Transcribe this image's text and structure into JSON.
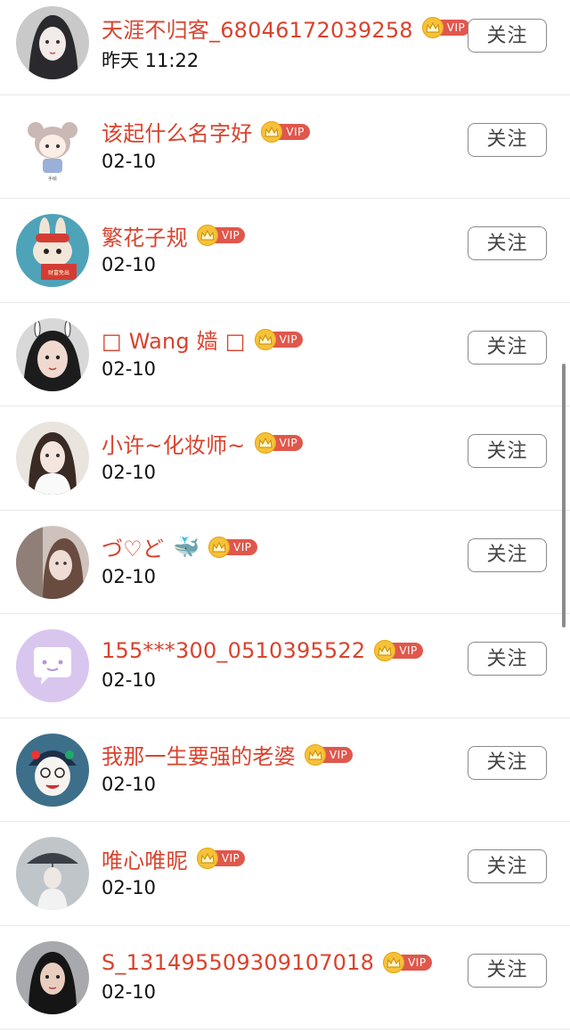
{
  "follow_label": "关注",
  "vip_label": "VIP",
  "colors": {
    "name": "#d9432e",
    "vip_badge": "#e0574c",
    "crown": "#f6c23a",
    "divider": "#e9e9e9"
  },
  "users": [
    {
      "name": "天涯不归客_68046172039258",
      "time": "昨天 11:22",
      "avatar": "girl-illustration-avatar"
    },
    {
      "name": "该起什么名字好",
      "time": "02-10",
      "avatar": "cartoon-girl-avatar"
    },
    {
      "name": "繁花子规",
      "time": "02-10",
      "avatar": "rabbit-avatar"
    },
    {
      "name": "□  Wang 嫱 □",
      "time": "02-10",
      "avatar": "selfie-avatar"
    },
    {
      "name": "小许~化妆师~",
      "time": "02-10",
      "avatar": "woman-photo-avatar"
    },
    {
      "name": "づ♡ど",
      "time": "02-10",
      "avatar": "woman-portrait-avatar",
      "emoji": "whale-emoji"
    },
    {
      "name": "155***300_0510395522",
      "time": "02-10",
      "avatar": "default-chat-avatar"
    },
    {
      "name": "我那一生要强的老婆",
      "time": "02-10",
      "avatar": "opera-cartoon-avatar"
    },
    {
      "name": "唯心唯昵",
      "time": "02-10",
      "avatar": "umbrella-girl-avatar"
    },
    {
      "name": "S_131495509309107018",
      "time": "02-10",
      "avatar": "woman-selfie-avatar"
    }
  ]
}
